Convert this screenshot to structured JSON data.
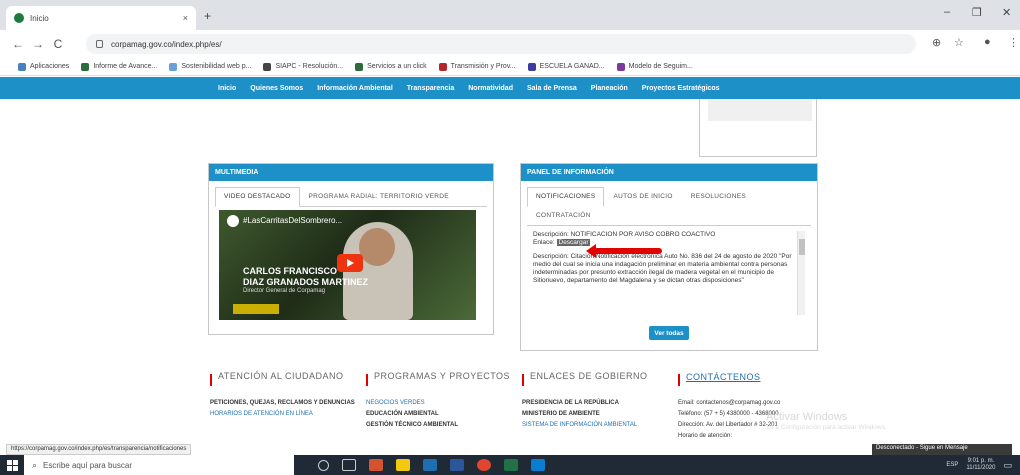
{
  "browser": {
    "tab_title": "Inicio",
    "tab_close": "×",
    "new_tab": "+",
    "url": "corpamag.gov.co/index.php/es/",
    "window_controls": [
      "–",
      "❐",
      "✕"
    ],
    "nav": [
      "←",
      "→",
      "C"
    ],
    "toolbar_right": [
      "⊕",
      "☆",
      "●",
      "⋮"
    ],
    "bookmarks": [
      "Aplicaciones",
      "Informe de Avance...",
      "Sostenibilidad web p...",
      "SIAPC - Resolución...",
      "Servicios a un click",
      "Transmisión y Prov...",
      "ESCUELA GANAD...",
      "Modelo de Seguim..."
    ]
  },
  "site_nav": [
    "Inicio",
    "Quienes Somos",
    "Información Ambiental",
    "Transparencia",
    "Normatividad",
    "Sala de Prensa",
    "Planeación",
    "Proyectos Estratégicos"
  ],
  "multimedia": {
    "header": "MULTIMEDIA",
    "tabs": [
      "VIDEO DESTACADO",
      "PROGRAMA RADIAL: TERRITORIO VERDE"
    ],
    "video": {
      "hashtag": "#LasCarritasDelSombrero...",
      "name_line1": "CARLOS FRANCISCO",
      "name_line2": "DIAZ GRANADOS MARTINEZ",
      "role": "Director General de Corpamag"
    }
  },
  "info": {
    "header": "PANEL DE INFORMACIÓN",
    "tabs": [
      "NOTIFICACIONES",
      "AUTOS DE INICIO",
      "RESOLUCIONES",
      "CONTRATACIÓN"
    ],
    "entry1_desc_label": "Descripción:",
    "entry1_desc": "NOTIFICACION POR AVISO COBRO COACTIVO",
    "entry1_link_label": "Enlace:",
    "entry1_link": "Descargar",
    "entry2_desc_label": "Descripción:",
    "entry2_desc": "Citación Notificación electrónica Auto No. 836 del 24 de agosto de 2020 \"Por medio del cual se inicia una indagación preliminar en materia ambiental contra personas indeterminadas por presunto extracción ilegal de madera vegetal en el municipio de Sitionuevo, departamento del Magdalena y se dictan otras disposiciones\"",
    "button": "Ver todas"
  },
  "footer": {
    "col1": {
      "title": "ATENCIÓN AL CIUDADANO",
      "items": [
        "PETICIONES, QUEJAS, RECLAMOS Y DENUNCIAS",
        "HORARIOS DE ATENCIÓN EN LÍNEA"
      ]
    },
    "col2": {
      "title": "PROGRAMAS Y PROYECTOS",
      "items": [
        "NEGOCIOS VERDES",
        "EDUCACIÓN AMBIENTAL",
        "GESTIÓN TÉCNICO AMBIENTAL"
      ]
    },
    "col3": {
      "title": "ENLACES DE GOBIERNO",
      "items": [
        "PRESIDENCIA DE LA REPÚBLICA",
        "MINISTERIO DE AMBIENTE",
        "SISTEMA DE INFORMACIÓN AMBIENTAL"
      ]
    },
    "col4": {
      "title": "CONTÁCTENOS",
      "items": [
        "Email: contactenos@corpamag.gov.co",
        "Teléfono: (57 + 5) 4380000 - 4368000",
        "Dirección: Av. del Libertador # 32-201",
        "Horario de atención:"
      ]
    }
  },
  "watermark": "Activar Windows",
  "watermark_sub": "Ve a Configuración para activar Windows.",
  "status_url": "https://corpamag.gov.co/index.php/es/transparencia/notificaciones",
  "notice": "Desconectado - Sigue en Mensaje",
  "taskbar": {
    "search_placeholder": "Escribe aquí para buscar",
    "tray_time": "9:01 p. m.",
    "tray_date": "11/11/2020",
    "tray_lang": "ESP"
  }
}
